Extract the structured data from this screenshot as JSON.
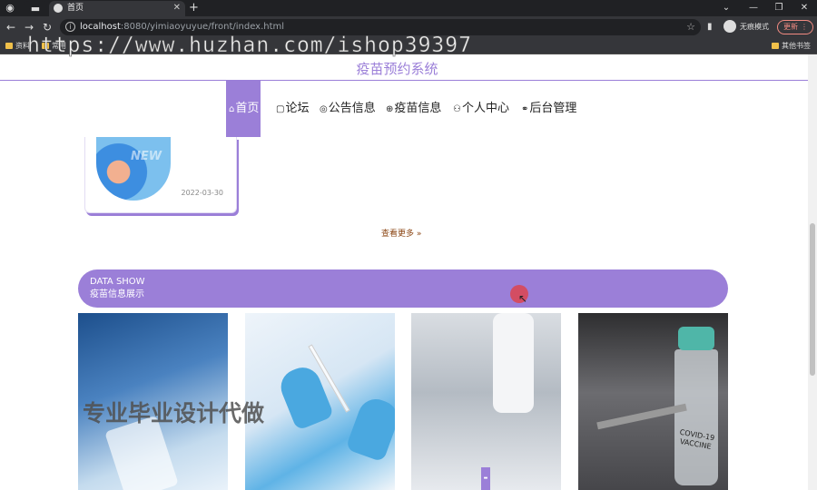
{
  "browser": {
    "tab_title": "首页",
    "url_host": "localhost",
    "url_rest": ":8080/yimiaoyuyue/front/index.html",
    "incognito_label": "无痕模式",
    "update_label": "更新",
    "bookmarks": [
      "资料",
      "常用"
    ],
    "other_bookmarks": "其他书签"
  },
  "watermark": {
    "url": "https://www.huzhan.com/ishop39397",
    "ad": "专业毕业设计代做"
  },
  "site": {
    "title": "疫苗预约系统",
    "nav": [
      {
        "icon": "⌂",
        "label": "首页"
      },
      {
        "icon": "▢",
        "label": "论坛"
      },
      {
        "icon": "◎",
        "label": "公告信息"
      },
      {
        "icon": "⊕",
        "label": "疫苗信息"
      },
      {
        "icon": "⚇",
        "label": "个人中心"
      },
      {
        "icon": "⚭",
        "label": "后台管理"
      }
    ]
  },
  "news": {
    "image_text": "NEW",
    "date": "2022-03-30",
    "more_label": "查看更多"
  },
  "data_show": {
    "title_en": "DATA SHOW",
    "title_cn": "疫苗信息展示"
  },
  "vaccine_card_4": {
    "label": "COVID-19 VACCINE"
  }
}
